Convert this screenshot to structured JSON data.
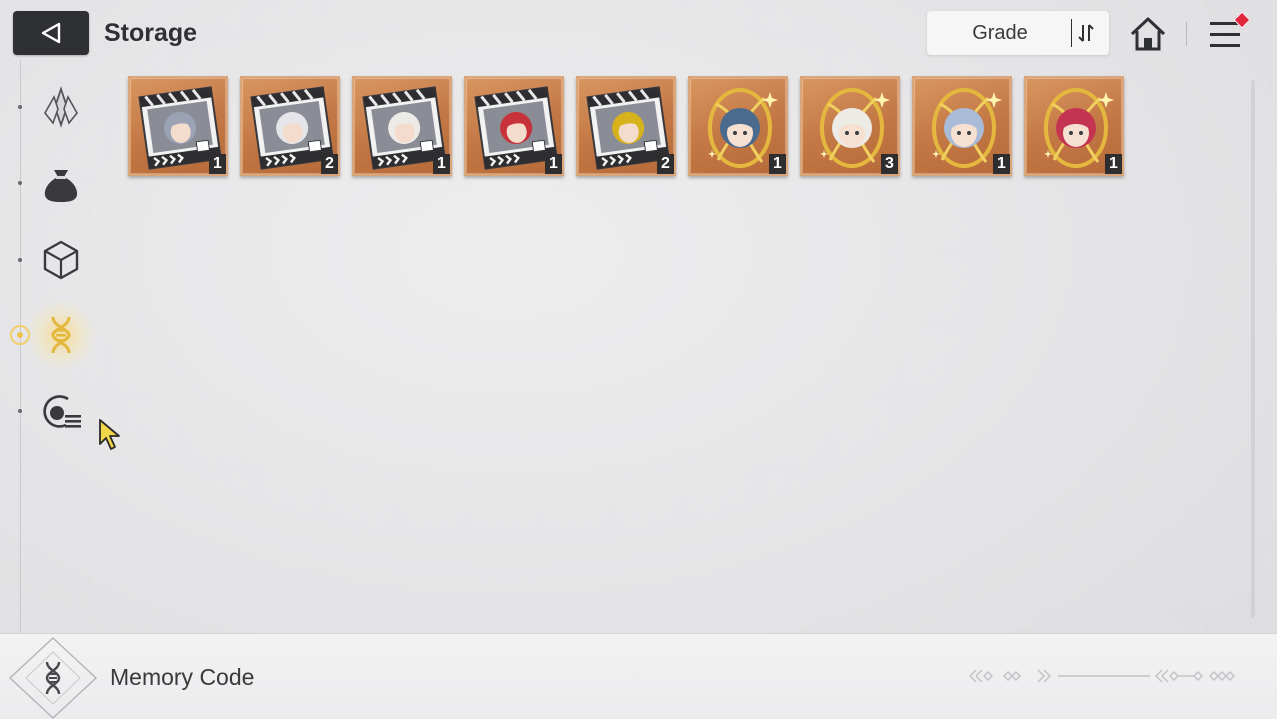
{
  "header": {
    "title": "Storage",
    "sort_label": "Grade"
  },
  "sidebar": {
    "tabs": [
      {
        "icon": "crystal-icon",
        "active": false
      },
      {
        "icon": "pouch-icon",
        "active": false
      },
      {
        "icon": "cube-icon",
        "active": false
      },
      {
        "icon": "dna-code-icon",
        "active": true
      },
      {
        "icon": "target-list-icon",
        "active": false
      }
    ]
  },
  "items": [
    {
      "kind": "film-card",
      "hair": "#9aa2b4",
      "count": "1"
    },
    {
      "kind": "film-card",
      "hair": "#e6e6ea",
      "count": "2"
    },
    {
      "kind": "film-card",
      "hair": "#ecebe8",
      "count": "1"
    },
    {
      "kind": "film-card",
      "hair": "#c8323a",
      "count": "1"
    },
    {
      "kind": "film-card",
      "hair": "#d8b21c",
      "count": "2"
    },
    {
      "kind": "memory-emblem",
      "hair": "#4a6a8e",
      "count": "1"
    },
    {
      "kind": "memory-emblem",
      "hair": "#ecebe6",
      "count": "3"
    },
    {
      "kind": "memory-emblem",
      "hair": "#a9bbd6",
      "count": "1"
    },
    {
      "kind": "memory-emblem",
      "hair": "#c43451",
      "count": "1"
    }
  ],
  "footer": {
    "label": "Memory Code"
  },
  "colors": {
    "card_bg": "#c27744",
    "accent_gold": "#e4b83e",
    "alert": "#e0263a",
    "dark_button": "#2f3033"
  }
}
